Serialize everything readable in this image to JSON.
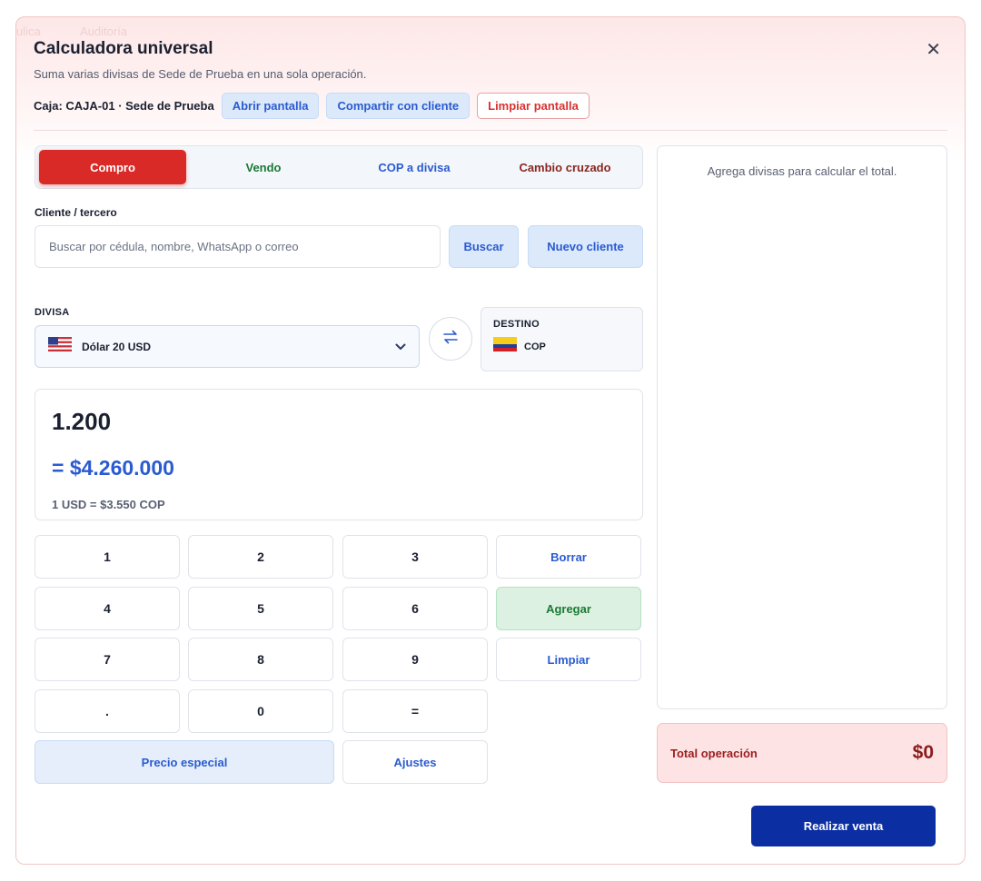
{
  "modal": {
    "title": "Calculadora universal",
    "subtitle": "Suma varias divisas de Sede de Prueba en una sola operación.",
    "caja_label": "Caja: CAJA-01 · Sede de Prueba",
    "buttons": {
      "abrir": "Abrir pantalla",
      "compartir": "Compartir con cliente",
      "limpiar": "Limpiar pantalla"
    },
    "close_icon": "close-icon",
    "background_nav": [
      "ulica",
      "Auditoría"
    ]
  },
  "tabs": [
    {
      "label": "Compro",
      "active": true
    },
    {
      "label": "Vendo",
      "active": false
    },
    {
      "label": "COP a divisa",
      "active": false
    },
    {
      "label": "Cambio cruzado",
      "active": false
    }
  ],
  "cliente": {
    "label": "Cliente / tercero",
    "placeholder": "Buscar por cédula, nombre, WhatsApp o correo",
    "value": "",
    "buscar": "Buscar",
    "nuevo": "Nuevo cliente"
  },
  "divisa": {
    "label": "DIVISA",
    "selected": "Dólar 20 USD",
    "flag": "us-flag-icon"
  },
  "destino": {
    "label": "DESTINO",
    "currency": "COP",
    "flag": "colombia-flag-icon"
  },
  "display": {
    "amount": "1.200",
    "converted": "= $4.260.000",
    "rate": "1 USD = $3.550 COP"
  },
  "keypad": {
    "k1": "1",
    "k2": "2",
    "k3": "3",
    "k4": "4",
    "k5": "5",
    "k6": "6",
    "k7": "7",
    "k8": "8",
    "k9": "9",
    "kdot": ".",
    "k0": "0",
    "keq": "=",
    "borrar": "Borrar",
    "agregar": "Agregar",
    "limpiar": "Limpiar",
    "precio_especial": "Precio especial",
    "ajustes": "Ajustes"
  },
  "summary": {
    "empty_text": "Agrega divisas para calcular el total.",
    "total_label": "Total operación",
    "total_value": "$0",
    "submit": "Realizar venta"
  },
  "colors": {
    "accent_red": "#d92a27",
    "accent_blue": "#2a5bd0",
    "accent_green": "#1b7a33",
    "primary_dark_blue": "#0b2fa3"
  }
}
